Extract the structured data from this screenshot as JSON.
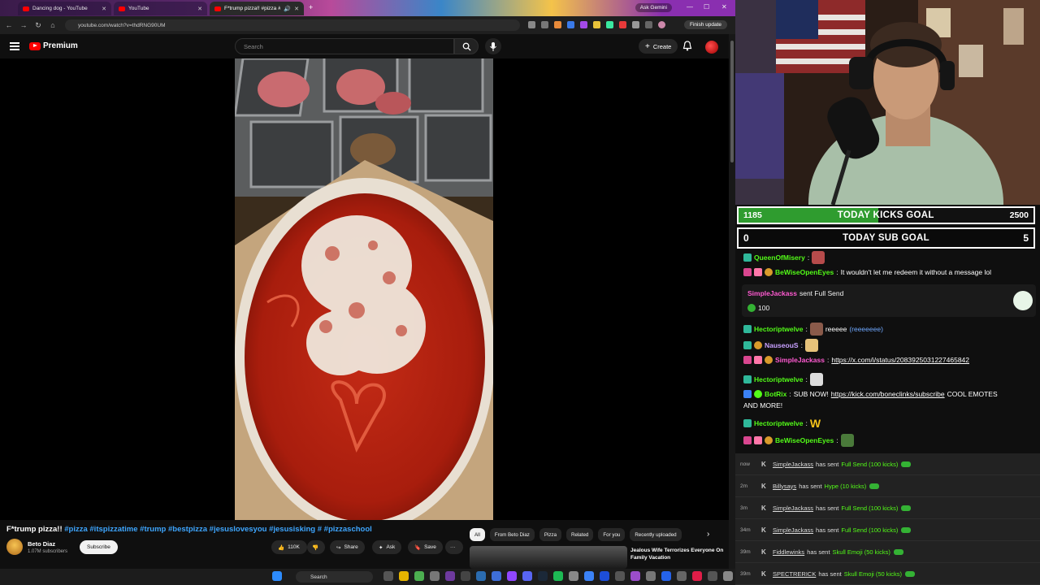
{
  "browser": {
    "tabs": [
      {
        "label": "Dancing dog - YouTube"
      },
      {
        "label": "YouTube"
      },
      {
        "label": "F*trump pizza!! #pizza #it..."
      }
    ],
    "gemini_label": "Ask Gemini",
    "url": "youtube.com/watch?v=thdRNG90UM",
    "finish_update": "Finish update"
  },
  "youtube": {
    "logo_text": "Premium",
    "search_placeholder": "Search",
    "create_label": "Create",
    "video": {
      "title": "F*trump pizza!!",
      "hashtags": "#pizza #itspizzatime #trump #bestpizza #jesuslovesyou #jesusisking # #pizzaschool",
      "channel": "Beto Diaz",
      "subscribers": "1.07M subscribers",
      "subscribe_label": "Subscribe",
      "likes": "110K",
      "share_label": "Share",
      "ask_label": "Ask",
      "save_label": "Save"
    },
    "chips": [
      "All",
      "From Beto Diaz",
      "Pizza",
      "Related",
      "For you",
      "Recently uploaded"
    ],
    "recommended": {
      "title": "Jealous Wife Terrorizes Everyone On Family Vacation"
    }
  },
  "taskbar": {
    "search_label": "Search"
  },
  "stream": {
    "kicks_goal": {
      "current": "1185",
      "label": "TODAY KICKS GOAL",
      "target": "2500",
      "progress": 0.474
    },
    "sub_goal": {
      "current": "0",
      "label": "TODAY SUB GOAL",
      "target": "5",
      "progress": 0.0
    },
    "chat": [
      {
        "user": "QueenOfMisery",
        "text": ""
      },
      {
        "user": "BeWiseOpenEyes",
        "text": "It wouldn't let me redeem it without a message lol"
      },
      {
        "user": "SimpleJackass",
        "text": "sent Full Send",
        "amount": "100"
      },
      {
        "user": "Hectoriptwelve",
        "text": "reeeee",
        "extra": "(reeeeeee)"
      },
      {
        "user": "NauseouS",
        "text": ""
      },
      {
        "user": "SimpleJackass",
        "text": "https://x.com/i/status/2083925031227465842"
      },
      {
        "user": "Hectoriptwelve",
        "text": ""
      },
      {
        "user": "BotRix",
        "text": "SUB NOW!",
        "link": "https://kick.com/boneclinks/subscribe",
        "after": "COOL EMOTES",
        "line2": "AND MORE!"
      },
      {
        "user": "Hectoriptwelve",
        "text": "W"
      },
      {
        "user": "BeWiseOpenEyes",
        "text": ""
      }
    ],
    "kick_log": [
      {
        "time": "now",
        "user": "SimpleJackass",
        "action": "has sent",
        "item": "Full Send (100 kicks)"
      },
      {
        "time": "2m",
        "user": "Billysays",
        "action": "has sent",
        "item": "Hype (10 kicks)"
      },
      {
        "time": "3m",
        "user": "SimpleJackass",
        "action": "has sent",
        "item": "Full Send (100 kicks)"
      },
      {
        "time": "34m",
        "user": "SimpleJackass",
        "action": "has sent",
        "item": "Full Send (100 kicks)"
      },
      {
        "time": "39m",
        "user": "Fiddlewinks",
        "action": "has sent",
        "item": "Skull Emoji (50 kicks)"
      },
      {
        "time": "39m",
        "user": "SPECTRERICK",
        "action": "has sent",
        "item": "Skull Emoji (50 kicks)"
      }
    ]
  }
}
